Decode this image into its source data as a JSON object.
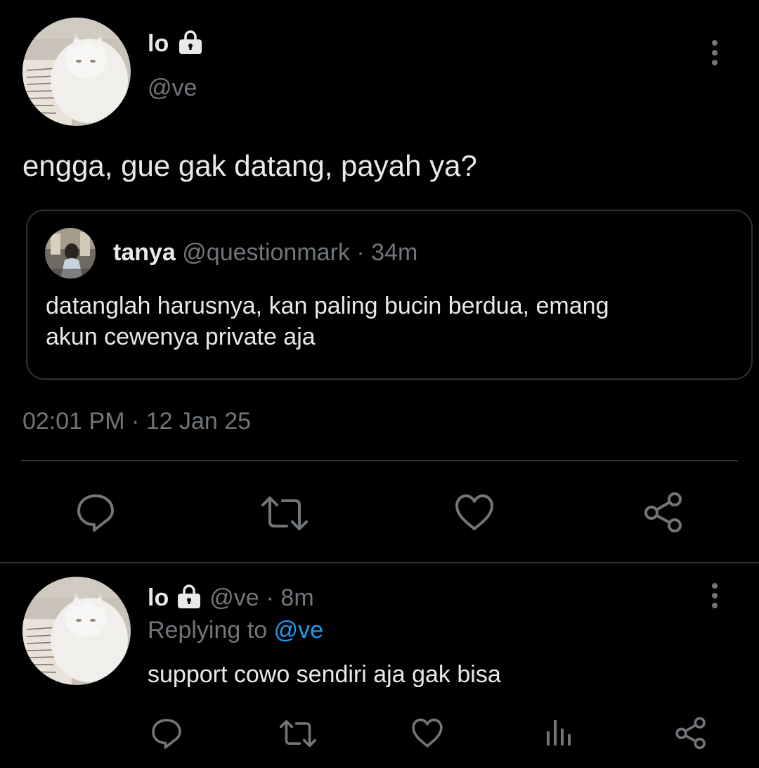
{
  "main_tweet": {
    "display_name": "lo",
    "handle": "@ve",
    "text": "engga, gue gak datang, payah ya?",
    "timestamp": "02:01 PM · 12 Jan 25",
    "quoted": {
      "display_name": "tanya",
      "handle": "@questionmark",
      "time": "· 34m",
      "text_line1": "datanglah harusnya, kan paling bucin berdua, emang",
      "text_line2": "akun cewenya private aja"
    },
    "actions": [
      "reply-icon",
      "retweet-icon",
      "like-icon",
      "share-icon"
    ]
  },
  "reply_tweet": {
    "display_name": "lo",
    "handle": "@ve",
    "time": "· 8m",
    "replying_prefix": "Replying to",
    "replying_handle": "@ve",
    "text": "support cowo sendiri aja gak bisa",
    "actions": [
      "reply-icon",
      "retweet-icon",
      "like-icon",
      "analytics-icon",
      "share-icon"
    ]
  },
  "colors": {
    "background": "#000000",
    "text": "#e7e9ea",
    "secondary": "#71767b",
    "link": "#1d9bf0",
    "divider": "#2f3336"
  }
}
